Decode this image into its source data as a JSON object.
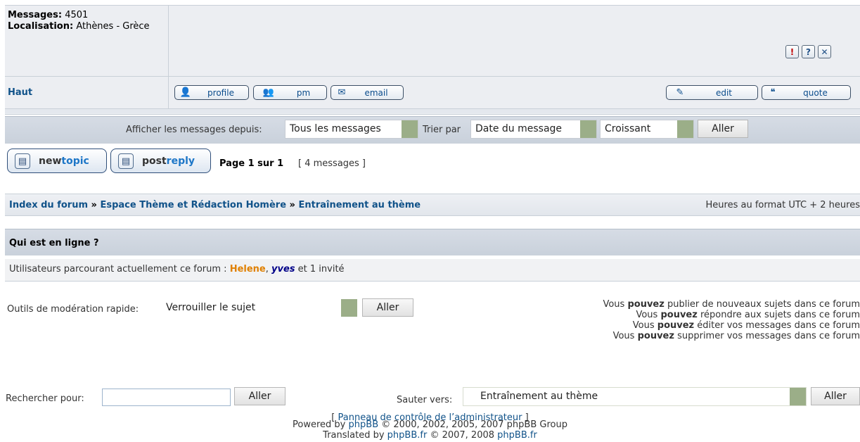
{
  "post": {
    "messages_label": "Messages:",
    "messages_value": "4501",
    "location_label": "Localisation:",
    "location_value": "Athènes - Grèce",
    "top_link": "Haut",
    "report_icon": "!",
    "info_icon": "?",
    "delete_icon": "✕",
    "profile_label": "profile",
    "pm_label": "pm",
    "email_label": "email",
    "edit_label": "edit",
    "quote_label": "quote"
  },
  "display": {
    "show_from_label": "Afficher les messages depuis:",
    "show_from_value": "Tous les messages",
    "sort_label": "Trier par",
    "sort_value": "Date du message",
    "order_value": "Croissant",
    "go_label": "Aller"
  },
  "actions": {
    "newtopic_a": "new",
    "newtopic_b": "topic",
    "postreply_a": "post",
    "postreply_b": "reply",
    "page_info": "Page 1 sur 1",
    "count_info": "[ 4 messages ]"
  },
  "breadcrumb": {
    "items": [
      "Index du forum",
      "Espace Thème et Rédaction Homère",
      "Entraînement au thème"
    ],
    "sep": "»",
    "timezone": "Heures au format UTC + 2 heures"
  },
  "online": {
    "title": "Qui est en ligne ?",
    "prefix": "Utilisateurs parcourant actuellement ce forum :",
    "user1": "Helene",
    "user2": "yves",
    "suffix": "et 1 invité"
  },
  "moderation": {
    "label": "Outils de modération rapide:",
    "value": "Verrouiller le sujet",
    "go_label": "Aller"
  },
  "permissions": {
    "word": "pouvez",
    "vous": "Vous",
    "lines": [
      "publier de nouveaux sujets dans ce forum",
      "répondre aux sujets dans ce forum",
      "éditer vos messages dans ce forum",
      "supprimer vos messages dans ce forum"
    ]
  },
  "search": {
    "label": "Rechercher pour:",
    "go_label": "Aller",
    "jump_label": "Sauter vers:",
    "jump_value": "Entraînement au thème",
    "jump_go": "Aller"
  },
  "admin_link": "Panneau de contrôle de l’administrateur",
  "footer": {
    "line1_prefix": "Powered by",
    "line1_link": "phpBB",
    "line1_suffix": "© 2000, 2002, 2005, 2007 phpBB Group",
    "line2_prefix": "Translated by",
    "line2_link1": "phpBB.fr",
    "line2_mid": "© 2007, 2008",
    "line2_link2": "phpBB.fr"
  },
  "colors": {
    "link": "#105289",
    "user_helene": "#e08000",
    "user_yves": "#000088",
    "select_arrow": "#9bae88"
  }
}
